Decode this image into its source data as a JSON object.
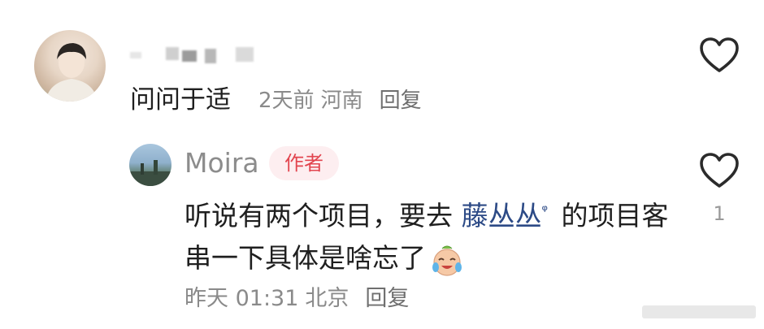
{
  "comment": {
    "text": "问问于适",
    "time": "2天前",
    "location": "河南",
    "reply_label": "回复"
  },
  "reply": {
    "author": "Moira",
    "badge": "作者",
    "text_before": "听说有两个项目，要去 ",
    "mention": "藤丛丛",
    "text_after": " 的项目客串一下具体是啥忘了",
    "time": "昨天 01:31",
    "location": "北京",
    "reply_label": "回复",
    "like_count": "1"
  },
  "colors": {
    "badge_bg": "#fdeef0",
    "badge_text": "#e2454f",
    "mention": "#2c4a86",
    "meta": "#8a8a8a"
  },
  "icons": {
    "like": "heart-outline-icon",
    "mention": "search-icon",
    "emoji": "crying-laughing-emoji"
  }
}
